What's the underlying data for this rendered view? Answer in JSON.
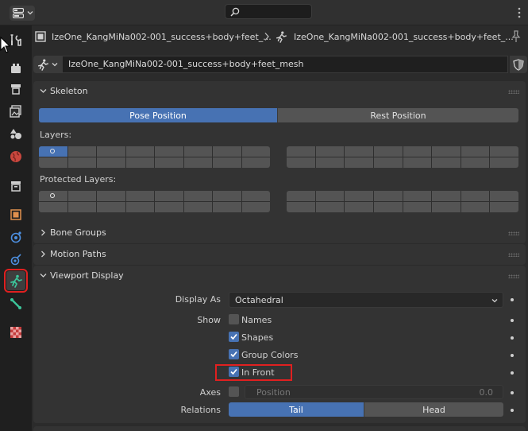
{
  "breadcrumb": {
    "object_name": "IzeOne_KangMiNa002-001_success+body+feet_...",
    "armature_name": "IzeOne_KangMiNa002-001_success+body+feet_..."
  },
  "datablock": {
    "name": "IzeOne_KangMiNa002-001_success+body+feet_mesh"
  },
  "skeleton": {
    "title": "Skeleton",
    "pose_position": "Pose Position",
    "rest_position": "Rest Position",
    "active_position": "pose",
    "layers_label": "Layers:",
    "protected_layers_label": "Protected Layers:"
  },
  "bone_groups": {
    "title": "Bone Groups"
  },
  "motion_paths": {
    "title": "Motion Paths"
  },
  "viewport_display": {
    "title": "Viewport Display",
    "display_as_label": "Display As",
    "display_as_value": "Octahedral",
    "show_label": "Show",
    "names_label": "Names",
    "names_checked": false,
    "shapes_label": "Shapes",
    "shapes_checked": true,
    "group_colors_label": "Group Colors",
    "group_colors_checked": true,
    "in_front_label": "In Front",
    "in_front_checked": true,
    "axes_label": "Axes",
    "axes_checked": false,
    "position_label": "Position",
    "position_value": "0.0",
    "relations_label": "Relations",
    "tail_label": "Tail",
    "head_label": "Head",
    "relations_active": "tail"
  },
  "colors": {
    "accent": "#4772b3",
    "highlight": "#e02020",
    "armature_icon": "#3cc69b"
  },
  "icons": {
    "tabs": [
      "tool-icon",
      "render-icon",
      "output-icon",
      "view-layer-icon",
      "scene-icon",
      "world-icon",
      "collection-icon",
      "object-icon",
      "modifier-icon",
      "particles-icon",
      "physics-icon",
      "armature-data-icon",
      "bone-icon",
      "texture-icon"
    ]
  }
}
